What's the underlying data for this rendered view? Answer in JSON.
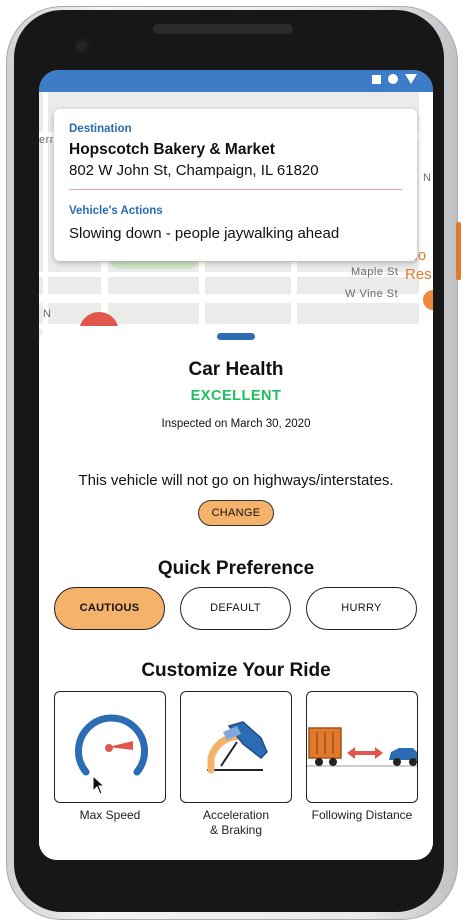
{
  "status_bar": {
    "icons": [
      "square-icon",
      "circle-icon",
      "triangle-icon"
    ],
    "color": "#3d7cc6"
  },
  "map": {
    "street_labels": [
      "Maple St",
      "W Vine St",
      "errat",
      "N",
      "N"
    ],
    "poi_text": [
      "Ro",
      "Res"
    ]
  },
  "info_card": {
    "destination_label": "Destination",
    "destination_name": "Hopscotch Bakery & Market",
    "destination_address": "802 W John St, Champaign, IL 61820",
    "actions_label": "Vehicle's Actions",
    "actions_text": "Slowing down - people jaywalking ahead"
  },
  "car_health": {
    "title": "Car Health",
    "status": "EXCELLENT",
    "inspected": "Inspected on March 30, 2020"
  },
  "highway_notice": "This vehicle will not go on highways/interstates.",
  "change_button": "CHANGE",
  "quick_preference": {
    "title": "Quick Preference",
    "options": [
      "CAUTIOUS",
      "DEFAULT",
      "HURRY"
    ],
    "selected": "CAUTIOUS"
  },
  "customize": {
    "title": "Customize Your Ride",
    "tiles": [
      {
        "label": "Max Speed",
        "icon": "speedometer-icon"
      },
      {
        "label": "Acceleration\n& Braking",
        "icon": "pedal-icon"
      },
      {
        "label": "Following Distance",
        "icon": "truck-car-distance-icon"
      }
    ]
  },
  "colors": {
    "accent": "#f5b26b",
    "excellent": "#1fbf62",
    "label_blue": "#2a6bb0",
    "brand_blue": "#2b6cb3"
  }
}
